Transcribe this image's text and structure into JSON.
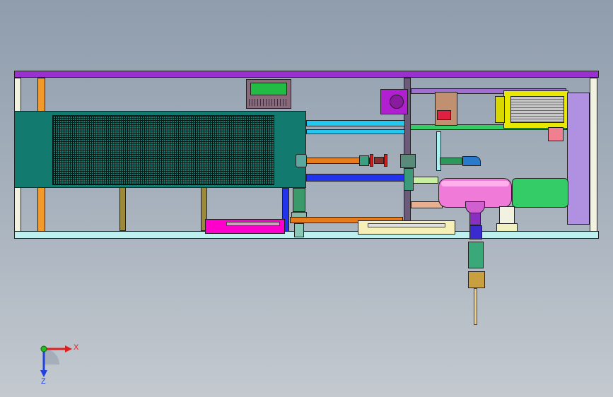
{
  "view": {
    "type": "CAD assembly - front view",
    "colors": {
      "background_top": "#8f9dad",
      "background_bottom": "#c3c9cf",
      "frame_top_rail": "#9b30d0",
      "frame_base_rail": "#bff0f0",
      "radiator_panel": "#127a6e",
      "motor": "#e8e800",
      "pump_housing": "#f07ad8",
      "pipe_green": "#33cc66",
      "pipe_cyan": "#22c8f0",
      "pipe_blue": "#2233ee",
      "pipe_orange": "#e57b1a",
      "magenta_tank": "#ff00cc"
    }
  },
  "triad": {
    "x_label": "X",
    "z_label": "Z",
    "x_color": "#e02020",
    "z_color": "#2040e0",
    "origin_color": "#20c020"
  }
}
